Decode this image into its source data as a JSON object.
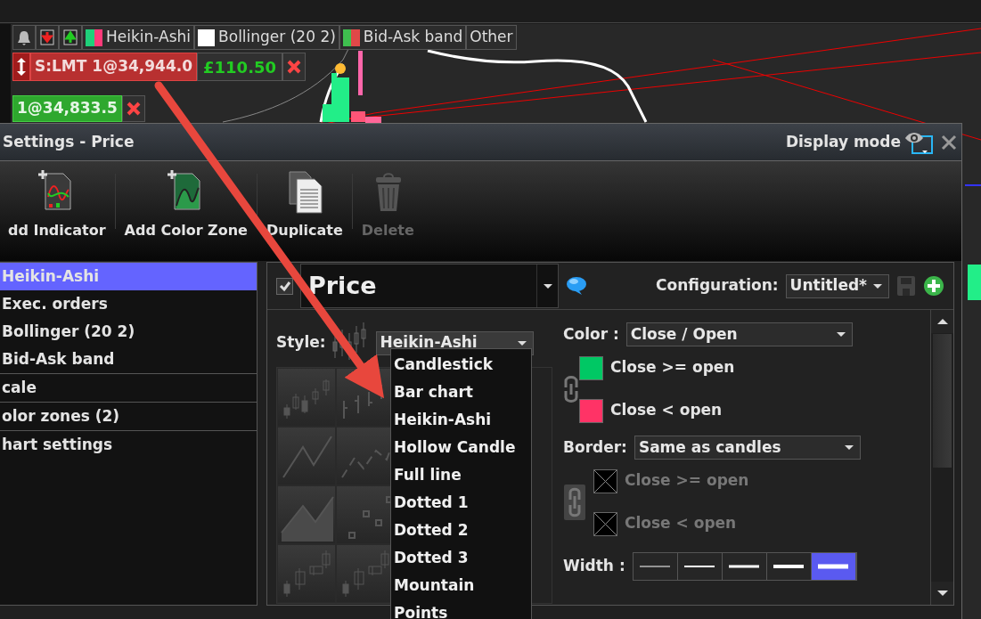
{
  "legend_toolbar": {
    "icons": [
      {
        "kind": "bell"
      },
      {
        "kind": "download"
      },
      {
        "kind": "upload"
      }
    ],
    "items": [
      {
        "label": "Heikin-Ashi",
        "swatches": [
          {
            "color": "#1fd07a"
          },
          {
            "color": "#ff3a7a"
          }
        ]
      },
      {
        "label": "Bollinger (20 2)",
        "swatches": [
          {
            "color": "#ffffff"
          }
        ]
      },
      {
        "label": "Bid-Ask band",
        "swatches": [
          {
            "color": "#3fbf4f"
          },
          {
            "color": "#e04848"
          }
        ]
      },
      {
        "label": "Other"
      }
    ]
  },
  "order_tags": [
    {
      "kind": "sell-limit",
      "label": "S:LMT 1@34,944.0",
      "pnl": "£110.50"
    },
    {
      "kind": "position",
      "label": "1@34,833.5"
    }
  ],
  "dialog": {
    "title": "Settings - Price",
    "display_mode": "Display mode",
    "toolbar": [
      {
        "kind": "indicator",
        "label": "dd Indicator",
        "disabled": false
      },
      {
        "kind": "color-zone",
        "label": "Add Color Zone",
        "disabled": false
      },
      {
        "kind": "duplicate",
        "label": "Duplicate",
        "disabled": false
      },
      {
        "kind": "delete",
        "label": "Delete",
        "disabled": true
      }
    ],
    "sidebar": {
      "items": [
        {
          "kind": "indicator",
          "label": "Heikin-Ashi",
          "selected": true
        },
        {
          "kind": "indicator",
          "label": "Exec. orders",
          "selected": false
        },
        {
          "kind": "indicator",
          "label": "Bollinger (20 2)",
          "selected": false
        },
        {
          "kind": "indicator",
          "label": "Bid-Ask band",
          "selected": false
        },
        {
          "kind": "section",
          "label": "cale",
          "selected": false
        },
        {
          "kind": "section",
          "label": "olor zones (2)",
          "selected": false
        },
        {
          "kind": "section",
          "label": "hart settings",
          "selected": false
        }
      ]
    },
    "panel": {
      "visible_checked": true,
      "name": "Price",
      "configuration_label": "Configuration:",
      "configuration": "Untitled*",
      "save_disabled": true,
      "style_label": "Style:",
      "style": "Heikin-Ashi",
      "style_options": [
        {
          "label": "Candlestick"
        },
        {
          "label": "Bar chart"
        },
        {
          "label": "Heikin-Ashi"
        },
        {
          "label": "Hollow Candle"
        },
        {
          "label": "Full line"
        },
        {
          "label": "Dotted 1"
        },
        {
          "label": "Dotted 2"
        },
        {
          "label": "Dotted 3"
        },
        {
          "label": "Mountain"
        },
        {
          "label": "Points"
        }
      ],
      "style_thumbnails": [
        {
          "kind": "candles"
        },
        {
          "kind": "bars"
        },
        {
          "kind": "line"
        },
        {
          "kind": "dotted"
        },
        {
          "kind": "mountain"
        },
        {
          "kind": "points"
        },
        {
          "kind": "hollow"
        },
        {
          "kind": "hollow"
        }
      ],
      "color_label": "Color :",
      "color_mode": "Close / Open",
      "color_swatches": [
        {
          "label": "Close >= open",
          "color": "#00c864",
          "disabled": false
        },
        {
          "label": "Close < open",
          "color": "#ff3366",
          "disabled": false
        }
      ],
      "border_label": "Border:",
      "border_mode": "Same as candles",
      "border_swatches": [
        {
          "label": "Close >= open",
          "color": "#000000",
          "disabled": true
        },
        {
          "label": "Close < open",
          "color": "#000000",
          "disabled": true
        }
      ],
      "width_label": "Width :",
      "width_options": [
        {
          "selected": false
        },
        {
          "selected": false
        },
        {
          "selected": false
        },
        {
          "selected": false
        },
        {
          "selected": true
        }
      ]
    }
  }
}
